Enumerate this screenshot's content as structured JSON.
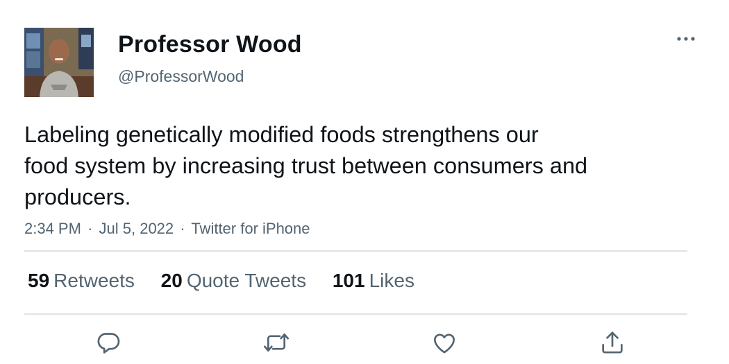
{
  "author": {
    "display_name": "Professor Wood",
    "handle": "@ProfessorWood",
    "avatar_icon": "profile-photo"
  },
  "more_icon": "more-horizontal-icon",
  "tweet": {
    "text_lines": [
      "Labeling genetically modified foods strengthens our",
      "food system by increasing trust between consumers and",
      "producers."
    ]
  },
  "meta": {
    "time": "2:34 PM",
    "date": "Jul 5, 2022",
    "source": "Twitter for iPhone",
    "separator": "·"
  },
  "stats": {
    "retweets": {
      "count": "59",
      "label": "Retweets"
    },
    "quotes": {
      "count": "20",
      "label": "Quote Tweets"
    },
    "likes": {
      "count": "101",
      "label": "Likes"
    }
  },
  "actions": [
    {
      "name": "reply",
      "icon": "reply-icon"
    },
    {
      "name": "retweet",
      "icon": "retweet-icon"
    },
    {
      "name": "like",
      "icon": "heart-icon"
    },
    {
      "name": "share",
      "icon": "share-icon"
    }
  ],
  "colors": {
    "primary_text": "#0f1419",
    "secondary_text": "#536471",
    "divider": "#dfe3e6",
    "icon": "#536471"
  }
}
